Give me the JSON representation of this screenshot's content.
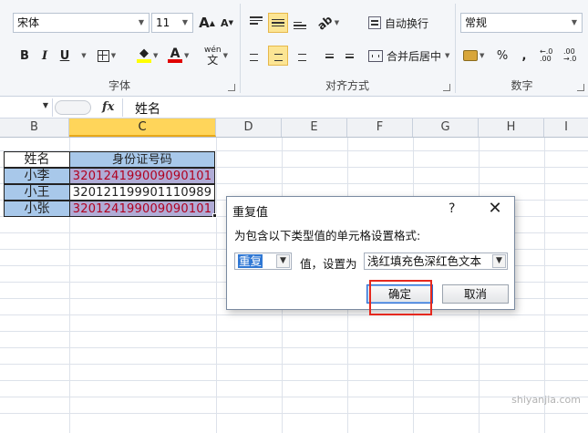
{
  "ribbon": {
    "font": {
      "font_name": "宋体",
      "font_size": "11",
      "bold": "B",
      "italic": "I",
      "underline": "U",
      "grow_icon_text": "A",
      "shrink_icon_text": "A",
      "font_color_text": "A",
      "phonetic_text": "wén",
      "label": "字体"
    },
    "alignment": {
      "wrap_text": "自动换行",
      "merge_center": "合并后居中",
      "label": "对齐方式"
    },
    "number": {
      "format": "常规",
      "percent": "%",
      "comma": ",",
      "inc_decimal": "←.0 .00",
      "dec_decimal": ".00 →.0",
      "label": "数字"
    }
  },
  "formula_bar": {
    "fx": "fx",
    "content": "姓名"
  },
  "columns": [
    "B",
    "C",
    "D",
    "E",
    "F",
    "G",
    "H",
    "I"
  ],
  "table": {
    "header": [
      "姓名",
      "身份证号码"
    ],
    "rows": [
      [
        "小李",
        "320124199009090101"
      ],
      [
        "小王",
        "320121199901110989"
      ],
      [
        "小张",
        "320124199009090101"
      ]
    ]
  },
  "dialog": {
    "title": "重复值",
    "help": "?",
    "close": "✕",
    "message": "为包含以下类型值的单元格设置格式:",
    "type_value": "重复",
    "mid_label": "值，设置为",
    "format_value": "浅红填充色深红色文本",
    "ok": "确定",
    "cancel": "取消"
  },
  "watermark": "shiyanjia.com",
  "colors": {
    "selected_header": "#ffd55a",
    "highlight_fill": "#a8c8ea",
    "duplicate_text": "#b00020",
    "annotation_red": "#e5281e"
  }
}
